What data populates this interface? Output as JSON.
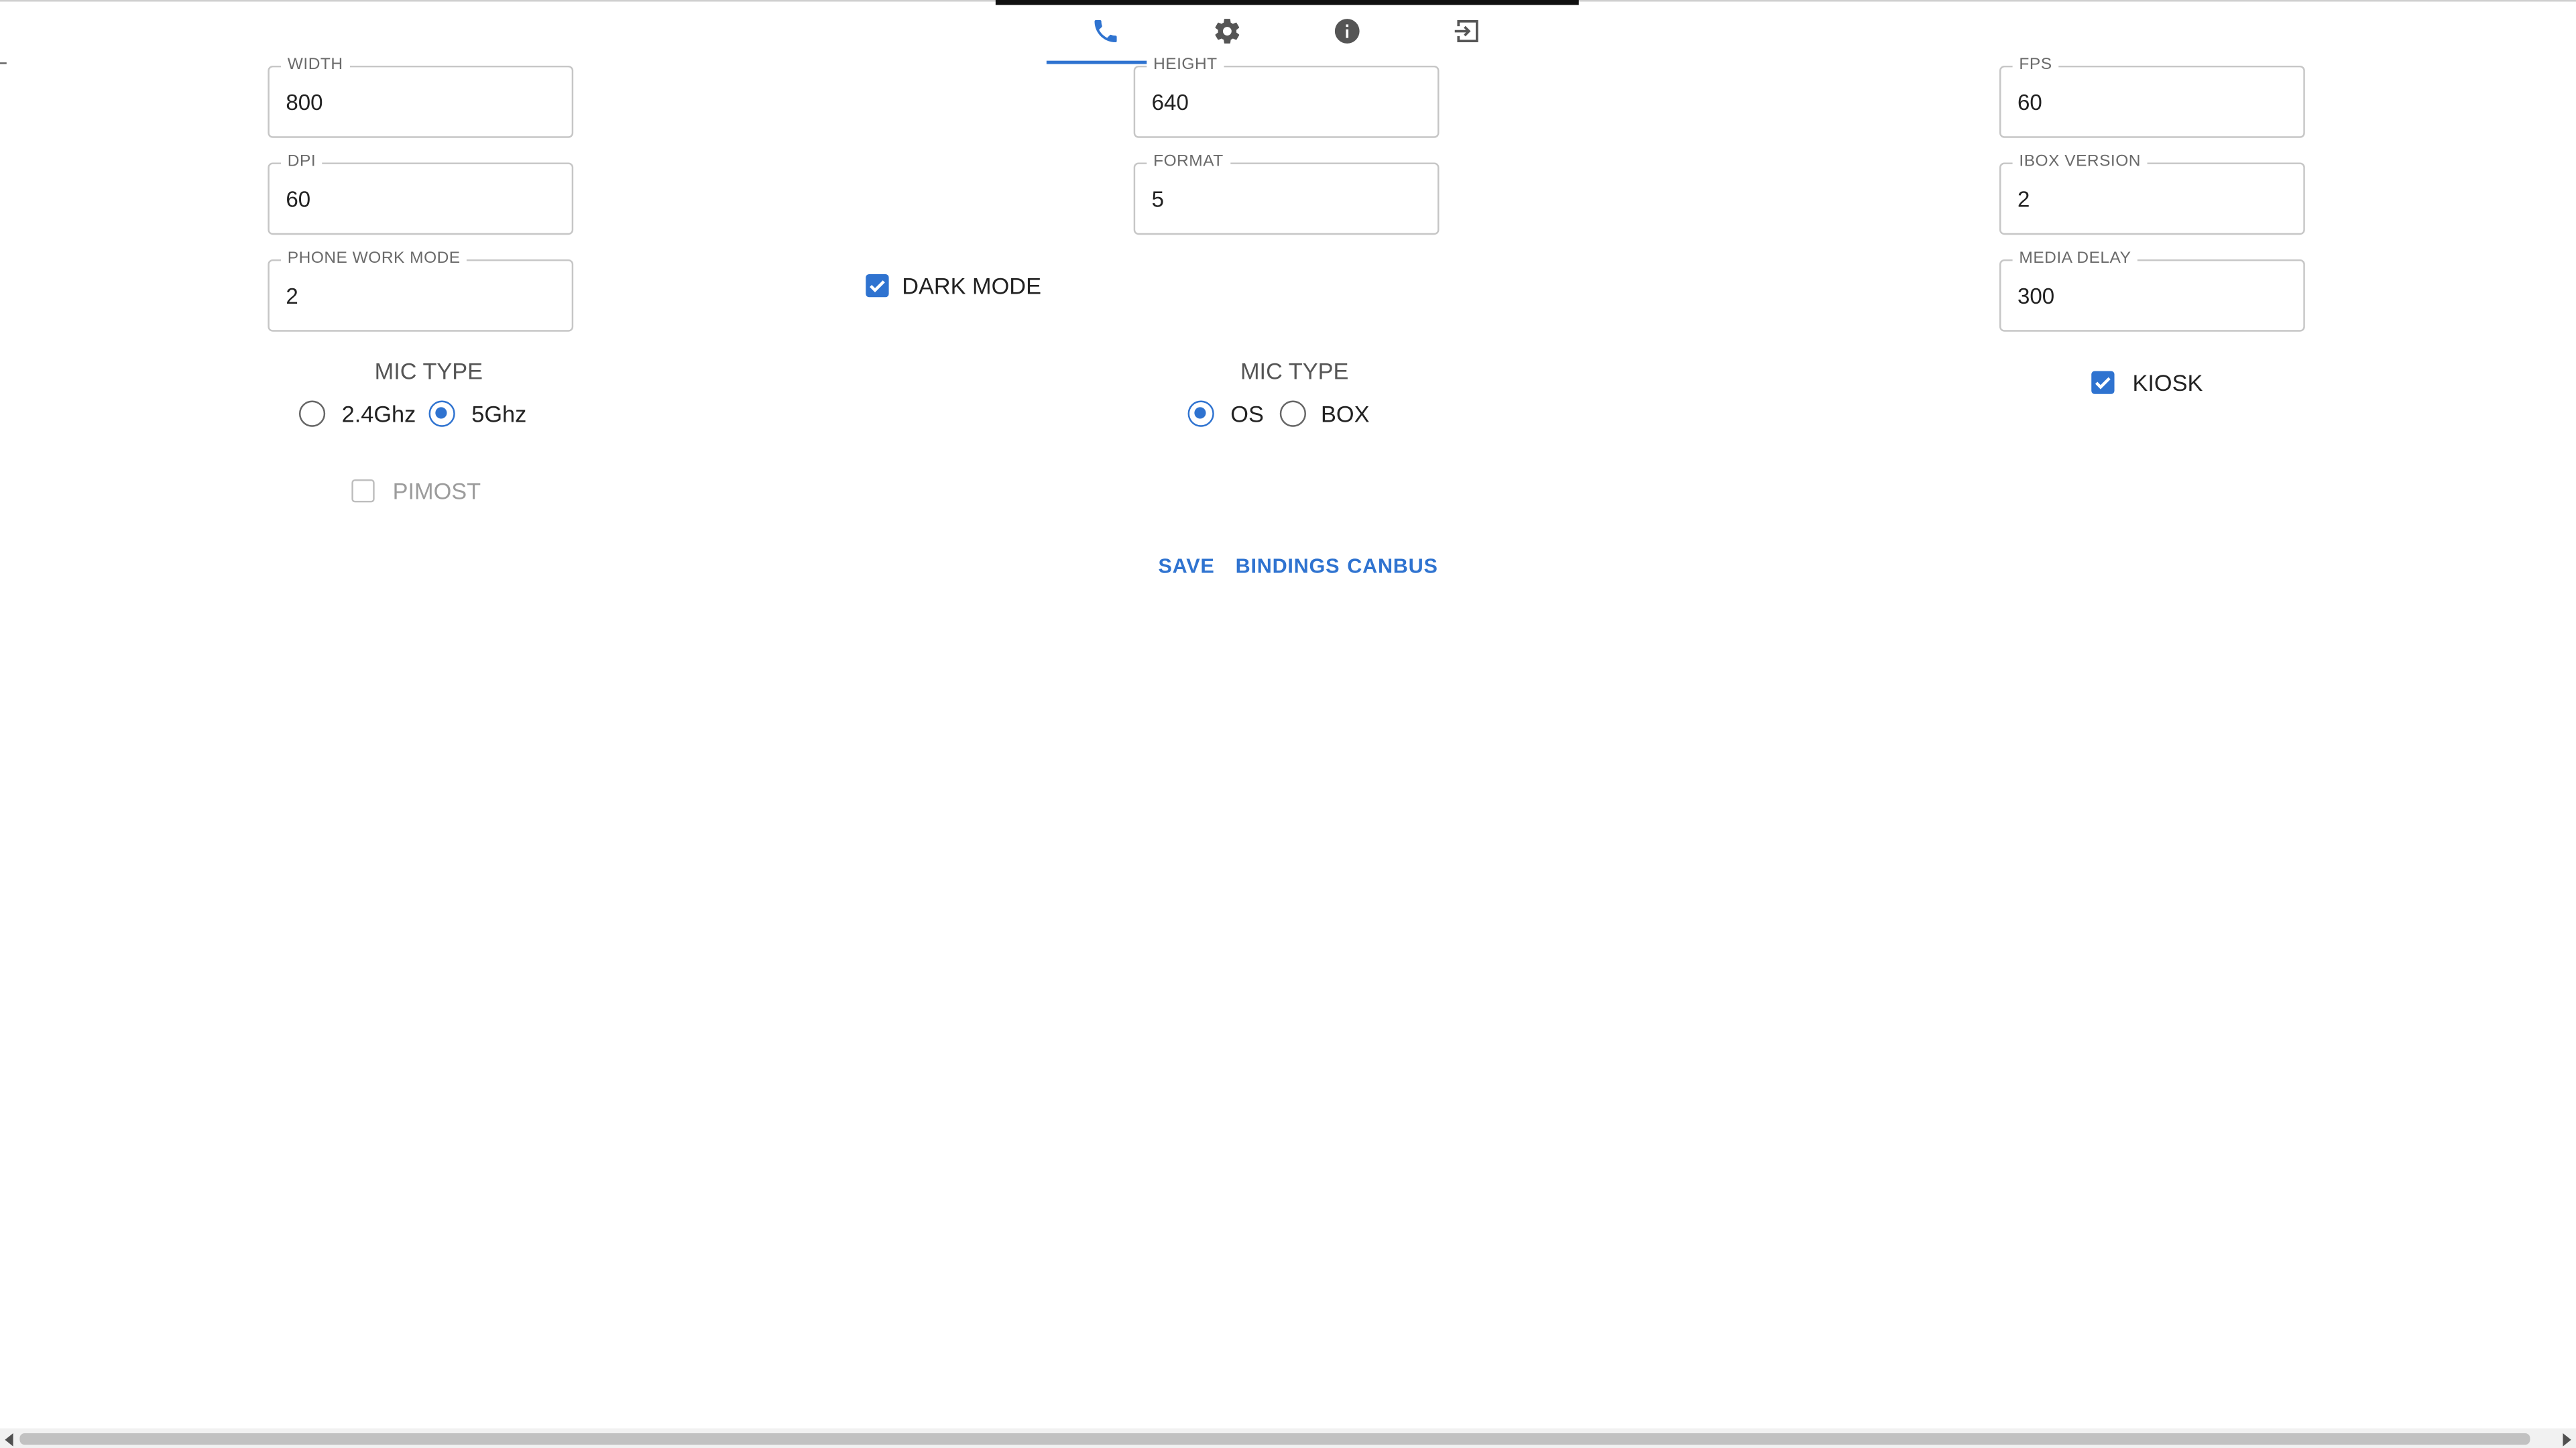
{
  "nav": {
    "tabs": [
      {
        "name": "phone",
        "icon": "phone-icon",
        "active": true
      },
      {
        "name": "settings",
        "icon": "gear-icon",
        "active": false
      },
      {
        "name": "info",
        "icon": "info-icon",
        "active": false
      },
      {
        "name": "exit",
        "icon": "exit-icon",
        "active": false
      }
    ]
  },
  "fields": {
    "width": {
      "label": "WIDTH",
      "value": "800"
    },
    "height": {
      "label": "HEIGHT",
      "value": "640"
    },
    "fps": {
      "label": "FPS",
      "value": "60"
    },
    "dpi": {
      "label": "DPI",
      "value": "60"
    },
    "format": {
      "label": "FORMAT",
      "value": "5"
    },
    "ibox_version": {
      "label": "IBOX VERSION",
      "value": "2"
    },
    "phone_work_mode": {
      "label": "PHONE WORK MODE",
      "value": "2"
    },
    "media_delay": {
      "label": "MEDIA DELAY",
      "value": "300"
    }
  },
  "checkboxes": {
    "dark_mode": {
      "label": "DARK MODE",
      "checked": true
    },
    "kiosk": {
      "label": "KIOSK",
      "checked": true
    },
    "pimost": {
      "label": "PIMOST",
      "checked": false,
      "disabled": true
    }
  },
  "wifi_group": {
    "title": "MIC TYPE",
    "options": [
      {
        "label": "2.4Ghz",
        "selected": false
      },
      {
        "label": "5Ghz",
        "selected": true
      }
    ]
  },
  "mic_group": {
    "title": "MIC TYPE",
    "options": [
      {
        "label": "OS",
        "selected": true
      },
      {
        "label": "BOX",
        "selected": false
      }
    ]
  },
  "actions": {
    "save": "SAVE",
    "bindings": "BINDINGS",
    "canbus": "CANBUS"
  },
  "colors": {
    "accent": "#2f73d0",
    "text": "#202020",
    "muted": "#6a6a6a",
    "border": "#c6c6c6"
  }
}
